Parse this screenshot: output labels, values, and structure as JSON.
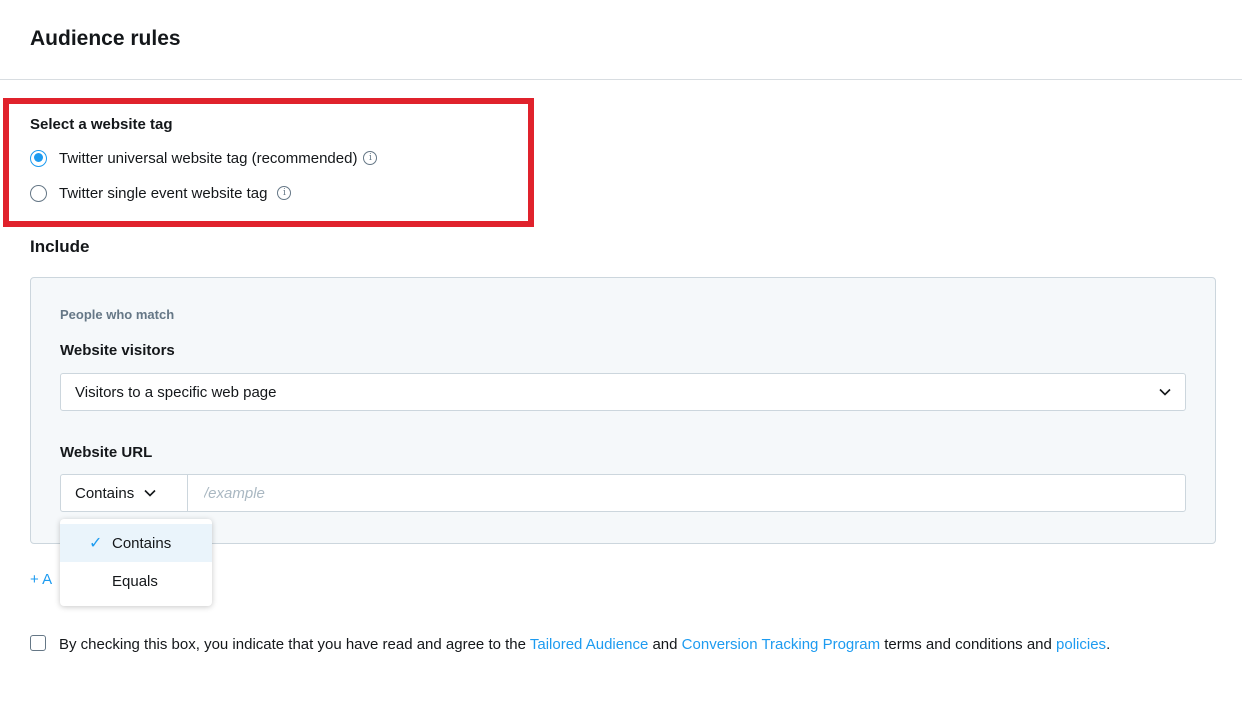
{
  "page": {
    "title": "Audience rules"
  },
  "website_tag": {
    "label": "Select a website tag",
    "options": [
      {
        "label": "Twitter universal website tag (recommended)",
        "selected": true
      },
      {
        "label": "Twitter single event website tag",
        "selected": false
      }
    ],
    "info_icon": "info-icon"
  },
  "include": {
    "heading": "Include",
    "people_match": "People who match",
    "visitors_label": "Website visitors",
    "visitors_value": "Visitors to a specific web page",
    "url_label": "Website URL",
    "operator_value": "Contains",
    "url_placeholder": "/example",
    "add_rule_prefix": "+ A"
  },
  "operator_menu": {
    "check_glyph": "✓",
    "options": [
      "Contains",
      "Equals"
    ],
    "selected": "Contains"
  },
  "terms": {
    "part1": "By checking this box, you indicate that you have read and agree to the ",
    "link1": "Tailored Audience",
    "part2": " and ",
    "link2": "Conversion Tracking Program",
    "part3": " terms and conditions and ",
    "link3": "policies",
    "part4": "."
  },
  "colors": {
    "accent": "#1d9bf0",
    "highlight": "#e0222c",
    "panel_bg": "#f5f8fa",
    "border": "#ccd6dd"
  }
}
